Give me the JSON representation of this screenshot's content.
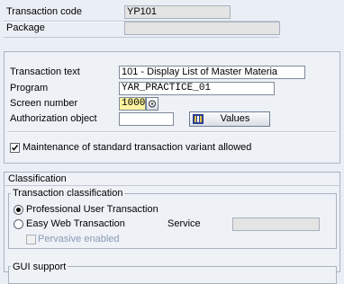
{
  "header": {
    "transaction_code_label": "Transaction code",
    "transaction_code_value": "YP101",
    "package_label": "Package",
    "package_value": ""
  },
  "details": {
    "transaction_text_label": "Transaction text",
    "transaction_text_value": "101 - Display List of Master Materia",
    "program_label": "Program",
    "program_value": "YAR_PRACTICE_01",
    "screen_number_label": "Screen number",
    "screen_number_value": "1000",
    "authorization_object_label": "Authorization object",
    "authorization_object_value": "",
    "values_button_label": "Values",
    "maintenance_checkbox_label": "Maintenance of standard transaction variant allowed",
    "maintenance_checked": true
  },
  "classification": {
    "title": "Classification",
    "transaction_classification_title": "Transaction classification",
    "professional_label": "Professional User Transaction",
    "easy_web_label": "Easy Web Transaction",
    "service_label": "Service",
    "service_value": "",
    "pervasive_label": "Pervasive enabled",
    "selected": "professional"
  },
  "gui_support": {
    "title": "GUI support"
  }
}
